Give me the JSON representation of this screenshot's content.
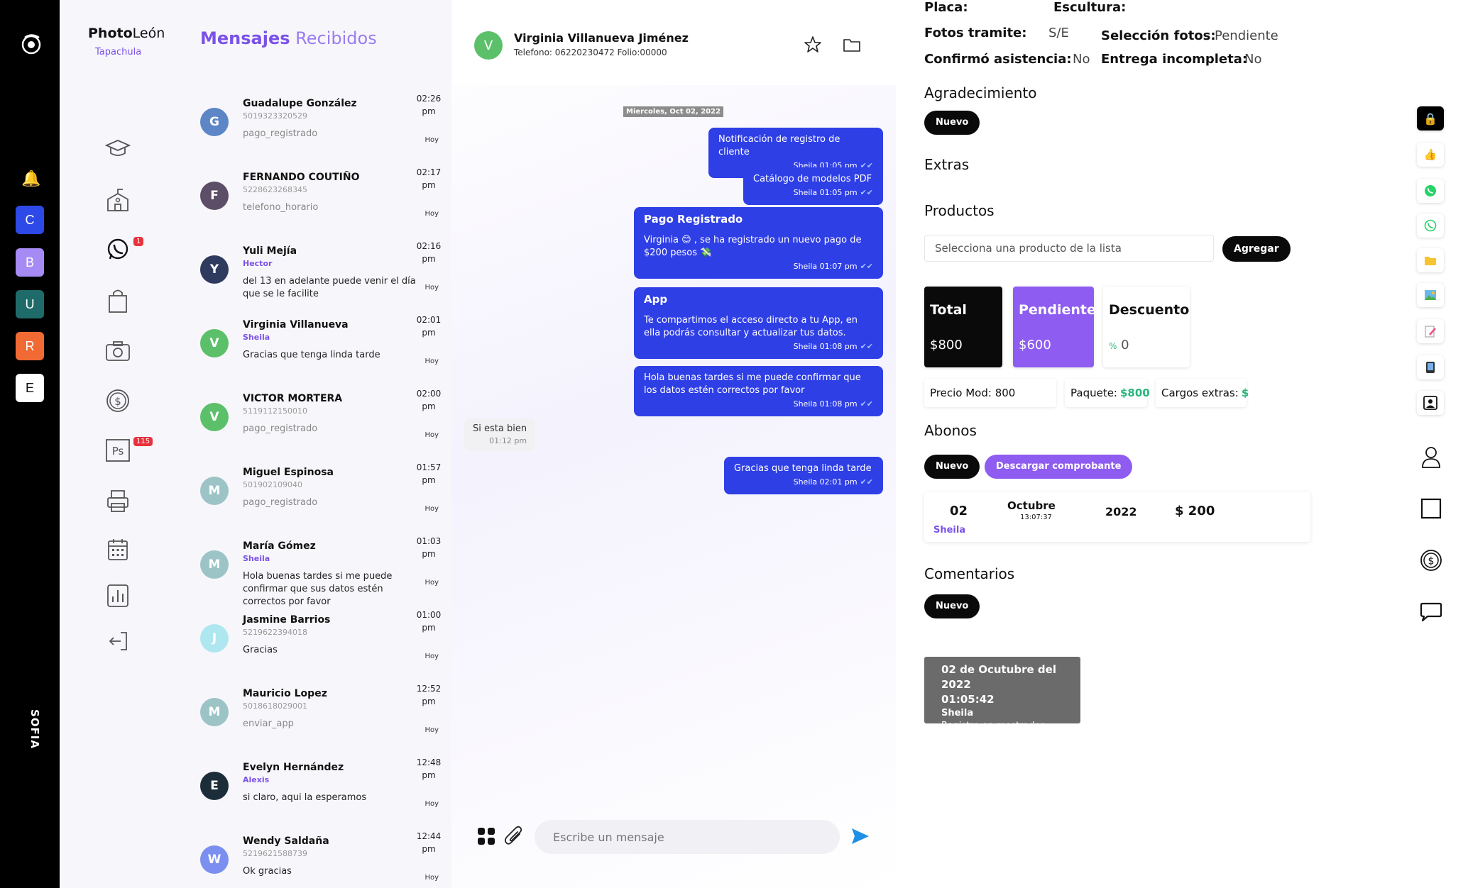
{
  "rail": {
    "squares": [
      {
        "letter": "C",
        "color": "#2d4ae8"
      },
      {
        "letter": "B",
        "color": "#a78bf5"
      },
      {
        "letter": "U",
        "color": "#1f6b6a"
      },
      {
        "letter": "R",
        "color": "#f26a33"
      },
      {
        "letter": "E",
        "color": "#ffffff"
      }
    ],
    "vertical_label": "SOFIA"
  },
  "nav": {
    "brand_bold": "Photo",
    "brand_light": "León",
    "branch": "Tapachula",
    "whatsapp_badge": "1",
    "ps_badge": "115",
    "ps_label": "Ps"
  },
  "list": {
    "title_bold": "Mensajes",
    "title_light": "Recibidos",
    "conversations": [
      {
        "initial": "G",
        "color": "#5d86c6",
        "name": "Guadalupe González",
        "sub": "5019323320529",
        "sub_agent": false,
        "msg": "pago_registrado",
        "msg_grey": true,
        "time_a": "02:26",
        "time_b": "pm",
        "day": "Hoy"
      },
      {
        "initial": "F",
        "color": "#5b4e66",
        "name": "FERNANDO COUTIÑO",
        "sub": "5228623268345",
        "sub_agent": false,
        "msg": "telefono_horario",
        "msg_grey": true,
        "time_a": "02:17",
        "time_b": "pm",
        "day": "Hoy"
      },
      {
        "initial": "Y",
        "color": "#2f3a5f",
        "name": "Yuli Mejía",
        "sub": "Hector",
        "sub_agent": true,
        "msg": "del 13 en adelante puede venir el día que se le facilite",
        "msg_grey": false,
        "time_a": "02:16",
        "time_b": "pm",
        "day": "Hoy"
      },
      {
        "initial": "V",
        "color": "#5cc06a",
        "name": "Virginia Villanueva",
        "sub": "Sheila",
        "sub_agent": true,
        "msg": "Gracias que tenga linda tarde",
        "msg_grey": false,
        "time_a": "02:01",
        "time_b": "pm",
        "day": "Hoy"
      },
      {
        "initial": "V",
        "color": "#5cc06a",
        "name": "VICTOR MORTERA",
        "sub": "5119112150010",
        "sub_agent": false,
        "msg": "pago_registrado",
        "msg_grey": true,
        "time_a": "02:00",
        "time_b": "pm",
        "day": "Hoy"
      },
      {
        "initial": "M",
        "color": "#9cc4c6",
        "name": "Miguel Espinosa",
        "sub": "501902109040",
        "sub_agent": false,
        "msg": "pago_registrado",
        "msg_grey": true,
        "time_a": "01:57",
        "time_b": "pm",
        "day": "Hoy"
      },
      {
        "initial": "M",
        "color": "#9cc4c6",
        "name": "María Gómez",
        "sub": "Sheila",
        "sub_agent": true,
        "msg": "Hola buenas tardes si me puede confirmar que sus datos estén correctos por favor",
        "msg_grey": false,
        "time_a": "01:03",
        "time_b": "pm",
        "day": "Hoy"
      },
      {
        "initial": "J",
        "color": "#aee7f0",
        "name": "Jasmine Barrios",
        "sub": "5219622394018",
        "sub_agent": false,
        "msg": "Gracias",
        "msg_grey": false,
        "time_a": "01:00",
        "time_b": "pm",
        "day": "Hoy"
      },
      {
        "initial": "M",
        "color": "#9cc4c6",
        "name": "Mauricio Lopez",
        "sub": "5018618029001",
        "sub_agent": false,
        "msg": "enviar_app",
        "msg_grey": true,
        "time_a": "12:52",
        "time_b": "pm",
        "day": "Hoy"
      },
      {
        "initial": "E",
        "color": "#1c2d3a",
        "name": "Evelyn Hernández",
        "sub": "Alexis",
        "sub_agent": true,
        "msg": "si claro, aqui la esperamos",
        "msg_grey": false,
        "time_a": "12:48",
        "time_b": "pm",
        "day": "Hoy"
      },
      {
        "initial": "W",
        "color": "#7b8ff0",
        "name": "Wendy Saldaña",
        "sub": "5219621588739",
        "sub_agent": false,
        "msg": "Ok gracias",
        "msg_grey": false,
        "time_a": "12:44",
        "time_b": "pm",
        "day": "Hoy"
      }
    ]
  },
  "chat": {
    "initial": "V",
    "name": "Virginia Villanueva Jiménez",
    "info": "Telefono: 06220230472 Folio:00000",
    "date_label": "Miercoles, Oct 02, 2022",
    "bubbles": [
      {
        "title": "",
        "text": "Notificación de registro de cliente",
        "meta": "Sheila 01:05 pm"
      },
      {
        "title": "",
        "text": "Catálogo de modelos PDF",
        "meta": "Sheila 01:05 pm"
      },
      {
        "title": "Pago Registrado",
        "text": "Virginia 😊 , se ha registrado un nuevo pago de $200 pesos 💸",
        "meta": "Sheila 01:07 pm"
      },
      {
        "title": "App",
        "text": "Te compartimos el acceso directo a tu App, en ella podrás consultar y actualizar tus datos.",
        "meta": "Sheila 01:08 pm"
      },
      {
        "title": "",
        "text": "Hola buenas tardes si me puede confirmar que los datos estén correctos por favor",
        "meta": "Sheila 01:08 pm"
      },
      {
        "title": "",
        "text": "Gracias que tenga linda tarde",
        "meta": "Sheila 02:01 pm"
      }
    ],
    "incoming": {
      "text": "Si esta bien",
      "time": "01:12 pm"
    },
    "composer_placeholder": "Escribe un mensaje"
  },
  "details": {
    "placa_label": "Placa:",
    "escultura_label": "Escultura:",
    "fotos_tramite_label": "Fotos tramite:",
    "fotos_tramite_value": "S/E",
    "seleccion_label": "Selección fotos:",
    "seleccion_value": "Pendiente",
    "confirmo_label": "Confirmó asistencia:",
    "confirmo_value": "No",
    "entrega_label": "Entrega incompleta:",
    "entrega_value": "No",
    "agradecimiento_title": "Agradecimiento",
    "nuevo_label": "Nuevo",
    "extras_title": "Extras",
    "productos_title": "Productos",
    "producto_placeholder": "Selecciona una producto de la lista",
    "agregar_label": "Agregar",
    "total_label": "Total",
    "total_value": "$800",
    "pendiente_label": "Pendiente",
    "pendiente_value": "$600",
    "descuento_label": "Descuento",
    "descuento_symbol": "%",
    "descuento_value": "0",
    "precio_mod_label": "Precio Mod:",
    "precio_mod_value": "800",
    "paquete_label": "Paquete:",
    "paquete_value": "$800",
    "cargos_label": "Cargos extras:",
    "cargos_value": "$",
    "abonos_title": "Abonos",
    "descargar_label": "Descargar comprobante",
    "abono": {
      "day": "02",
      "agent": "Sheila",
      "month": "Octubre",
      "time": "13:07:37",
      "year": "2022",
      "amount": "$ 200"
    },
    "comentarios_title": "Comentarios",
    "comment": {
      "date": "02 de Ocutubre del 2022",
      "time": "01:05:42",
      "agent": "Sheila",
      "text": "Registro en mostrador"
    }
  },
  "colors": {
    "accent": "#7b52e8",
    "bubble": "#2f3fe6",
    "green": "#27b77a"
  }
}
